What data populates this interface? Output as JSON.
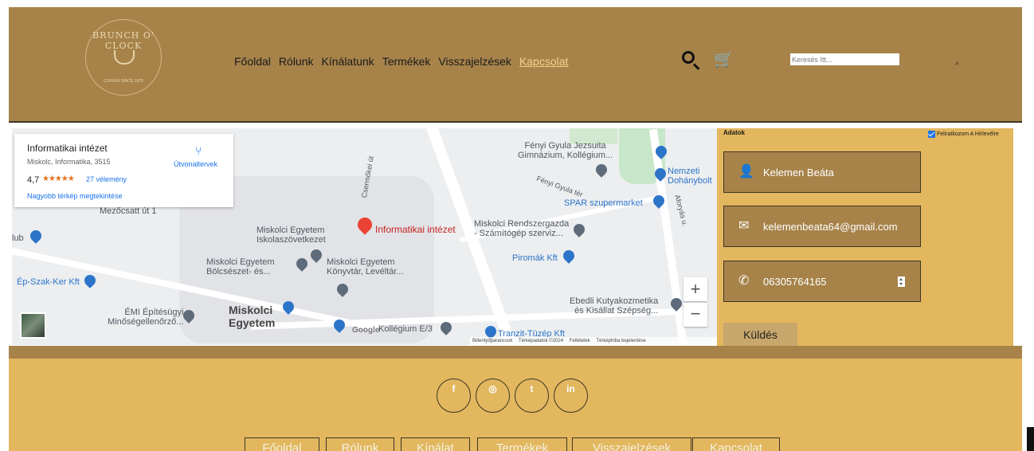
{
  "logo": {
    "text_top": "BRUNCH O' CLOCK",
    "text_bottom": "COFFEE  SINCE 1975"
  },
  "nav": {
    "items": [
      "Főoldal",
      "Rólunk",
      "Kínálatunk",
      "Termékek",
      "Visszajelzések",
      "Kapcsolat"
    ],
    "active": "Kapcsolat"
  },
  "header": {
    "search_icon": "magnifier-icon",
    "cart_icon": "cart-icon",
    "search_placeholder": "Keresés Itt...",
    "search_button_glyph": "⌕"
  },
  "map": {
    "card": {
      "title": "Informatikai intézet",
      "address": "Miskolc, Informatika, 3515",
      "rating": "4,7",
      "stars": "★★★★★",
      "reviews": "27 vélemény",
      "larger_map": "Nagyobb térkép megtekintése",
      "directions": "Útvonaltervek"
    },
    "pin_label": "Informatikai intézet",
    "labels": {
      "l1": "Fényi Gyula Jezsuita",
      "l1b": "Gimnázium, Kollégium...",
      "l2": "Nemzeti",
      "l2b": "Dohánybolt",
      "l3": "SPAR szupermarket",
      "l4": "Miskolci Rendszergazda",
      "l4b": "- Számítógép szerviz...",
      "l5": "Piromák Kft",
      "l6": "Miskolci Egyetem",
      "l6b": "Iskolaszövetkezet",
      "l7": "Miskolci Egyetem",
      "l7b": "Bölcsészet- és...",
      "l8": "Miskolci Egyetem",
      "l8b": "Könyvtár, Levéltár...",
      "l9": "Ép-Szak-Ker Kft",
      "l10": "ÉMI Építésügyi",
      "l10b": "Minőségellenőrző...",
      "l11": "Miskolci",
      "l11b": "Egyetem",
      "l12": "Kollégium E/3",
      "l13": "Tranzit-Tüzép Kft",
      "l14": "Ebedli Kutyakozmetika",
      "l14b": "és Kisállat Szépség...",
      "l15": "Mezőcsatt út 1",
      "l16": "lub",
      "l17": "Csermőkei út",
      "l18": "Fényi Gyula tér",
      "l19": "Aforyás u."
    },
    "google": "Google",
    "footer": [
      "Billentyűparancsok",
      "Térképadatok ©2024",
      "Feltételek",
      "Térképhiba bejelentése"
    ],
    "zoom_in": "+",
    "zoom_out": "−"
  },
  "form": {
    "title": "Adatok",
    "newsletter": "Feliratkozom A Hírlevélre",
    "newsletter_checked": true,
    "name": "Kelemen Beáta",
    "email": "kelemenbeata64@gmail.com",
    "phone": "06305764165",
    "send": "Küldés"
  },
  "footer": {
    "social": [
      "f",
      "◎",
      "t",
      "in"
    ],
    "links": [
      "Főoldal",
      "Rólunk",
      "Kínálat",
      "Termékek",
      "Visszajelzések",
      "Kapcsolat"
    ]
  },
  "colors": {
    "header_bg": "#a7834a",
    "panel_bg": "#e2b75e",
    "field_bg": "#a7834a",
    "active_nav": "#f2d38b",
    "pin_red": "#ea4335"
  }
}
